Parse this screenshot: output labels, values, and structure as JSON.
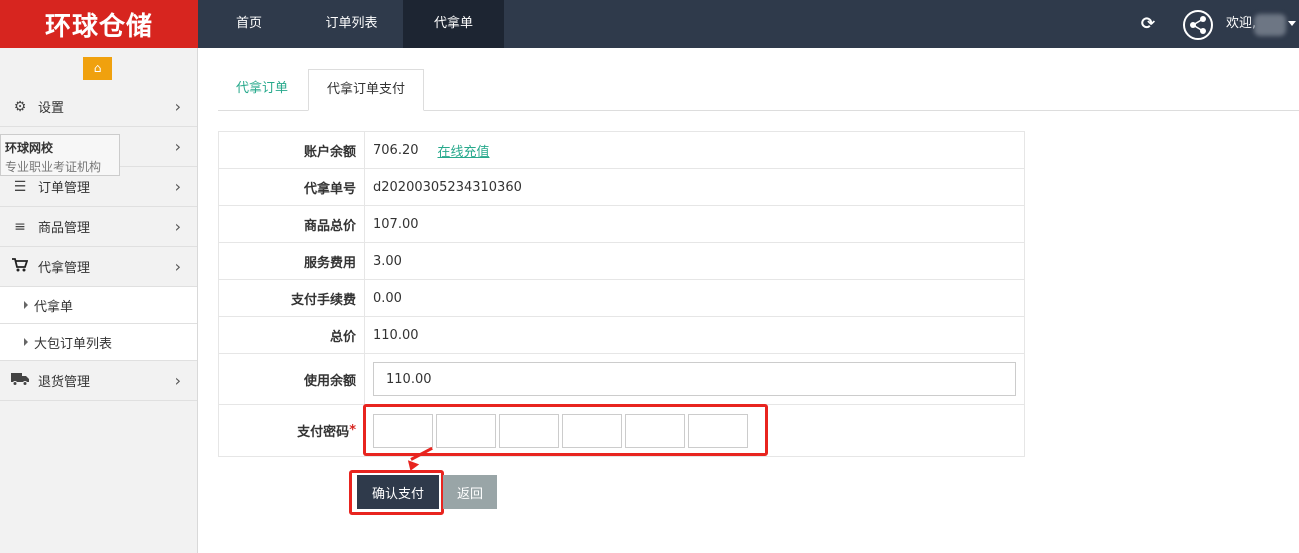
{
  "brand": {
    "logo_text": "环球仓储"
  },
  "topnav": {
    "items": [
      {
        "label": "首页"
      },
      {
        "label": "订单列表"
      },
      {
        "label": "代拿单"
      }
    ],
    "welcome": "欢迎,"
  },
  "sidebar": {
    "items": [
      {
        "label": "设置",
        "icon": "gears-icon"
      },
      {
        "label": "",
        "icon": "blank"
      },
      {
        "label": "订单管理",
        "icon": "bars-icon"
      },
      {
        "label": "商品管理",
        "icon": "list-icon"
      },
      {
        "label": "代拿管理",
        "icon": "cart-icon"
      },
      {
        "label": "退货管理",
        "icon": "truck-icon"
      }
    ],
    "subitems": [
      {
        "label": "代拿单"
      },
      {
        "label": "大包订单列表"
      }
    ],
    "tooltip": {
      "title": "环球网校",
      "subtitle": "专业职业考证机构"
    }
  },
  "tabs": [
    {
      "label": "代拿订单",
      "active": false
    },
    {
      "label": "代拿订单支付",
      "active": true
    }
  ],
  "form": {
    "rows": [
      {
        "label": "账户余额",
        "value": "706.20",
        "link": "在线充值"
      },
      {
        "label": "代拿单号",
        "value": "d20200305234310360"
      },
      {
        "label": "商品总价",
        "value": "107.00"
      },
      {
        "label": "服务费用",
        "value": "3.00"
      },
      {
        "label": "支付手续费",
        "value": "0.00"
      },
      {
        "label": "总价",
        "value": "110.00"
      }
    ],
    "use_balance": {
      "label": "使用余额",
      "value": "110.00"
    },
    "password": {
      "label": "支付密码",
      "required_mark": "*",
      "digits": 6
    }
  },
  "buttons": {
    "confirm": "确认支付",
    "back": "返回"
  },
  "colors": {
    "topbar": "#2f3a4b",
    "brand_red": "#d7251f",
    "link_green": "#27a98c",
    "home_orange": "#f0a10e",
    "annotation_red": "#e8241f"
  }
}
